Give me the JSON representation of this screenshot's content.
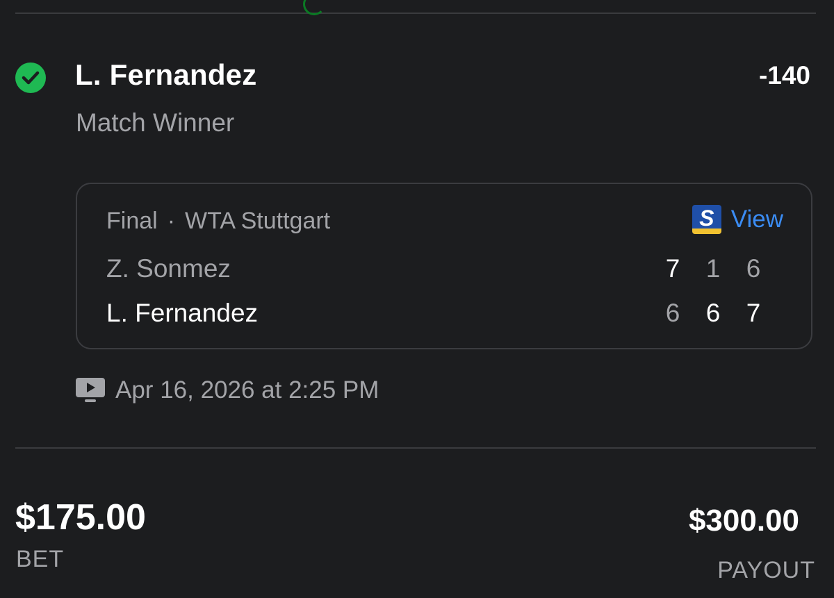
{
  "selection": {
    "name": "L. Fernandez",
    "market": "Match Winner",
    "odds": "-140",
    "status_icon": "check-circle-icon",
    "status_color": "#1fb953"
  },
  "event": {
    "status": "Final",
    "separator": "·",
    "tournament": "WTA Stuttgart",
    "provider_icon": "score-app-logo-icon",
    "view_label": "View",
    "link_color": "#3b8cf3",
    "players": [
      {
        "name": "Z. Sonmez",
        "sets": [
          "7",
          "1",
          "6"
        ],
        "set_won": [
          true,
          false,
          false
        ]
      },
      {
        "name": "L. Fernandez",
        "sets": [
          "6",
          "6",
          "7"
        ],
        "set_won": [
          false,
          true,
          true
        ]
      }
    ]
  },
  "schedule": {
    "icon": "tv-play-icon",
    "datetime": "Apr 16, 2026 at 2:25 PM"
  },
  "wager": {
    "bet_amount": "$175.00",
    "bet_label": "BET",
    "payout_amount": "$300.00",
    "payout_label": "PAYOUT"
  }
}
